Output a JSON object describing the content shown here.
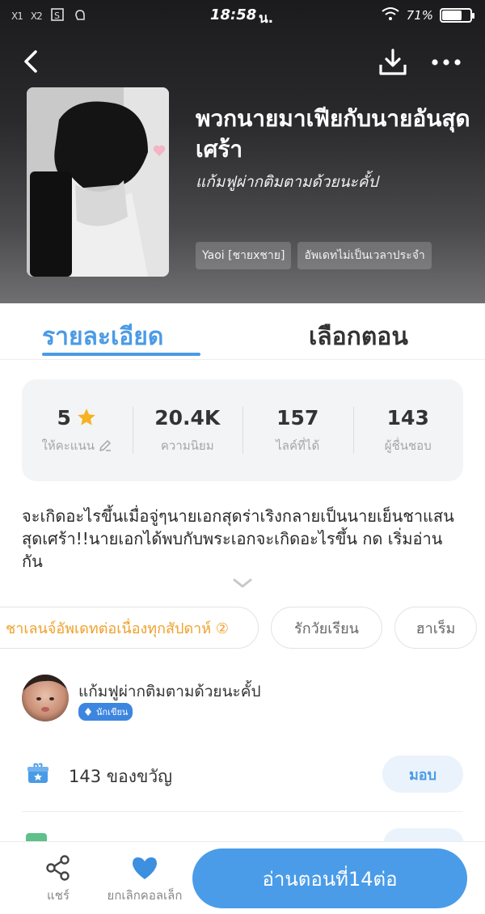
{
  "status_bar": {
    "sim1": "X1",
    "sim2": "X2",
    "time": "18:58",
    "carrier_mark": "น.",
    "battery_text": "71%",
    "battery_level": 0.71
  },
  "header": {
    "title": "พวกนายมาเฟียกับนายอันสุดเศร้า",
    "author": "แก้มฟูผ่ากติมตามด้วยนะคั้ป",
    "tags": [
      "Yaoi [ชายxชาย]",
      "อัพเดทไม่เป็นเวลาประจำ"
    ]
  },
  "tabs": [
    {
      "label": "รายละเอียด",
      "active": true
    },
    {
      "label": "เลือกตอน",
      "active": false
    }
  ],
  "stats": [
    {
      "value": "5",
      "label": "ให้คะแนน",
      "icon": "star-icon"
    },
    {
      "value": "20.4K",
      "label": "ความนิยม"
    },
    {
      "value": "157",
      "label": "ไลค์ที่ได้"
    },
    {
      "value": "143",
      "label": "ผู้ชื่นชอบ"
    }
  ],
  "synopsis": "จะเกิดอะไรขึ้นเมื่อจู่ๆนายเอกสุดร่าเริงกลายเป็นนายเย็นชาแสนสุดเศร้า!!นายเอกได้พบกับพระเอกจะเกิดอะไรขึ้น กด เริ่มอ่าน กัน",
  "chips": [
    {
      "label": "ชาเลนจ์อัพเดทต่อเนื่องทุกสัปดาห์ ②",
      "highlight": true
    },
    {
      "label": "รักวัยเรียน",
      "highlight": false
    },
    {
      "label": "ฮาเร็ม",
      "highlight": false
    }
  ],
  "author_section": {
    "name": "แก้มฟูผ่ากติมตามด้วยนะคั้ป",
    "badge": "นักเขียน"
  },
  "gift": {
    "text": "143 ของขวัญ",
    "button": "มอบ"
  },
  "bottom_bar": {
    "share_label": "แชร์",
    "fav_label": "ยกเลิกคอลเล็ก",
    "read_button": "อ่านตอนที่14ต่อ"
  },
  "colors": {
    "accent": "#4a9be6",
    "highlight_chip": "#f0a02a",
    "star": "#f5b321",
    "writer_badge": "#3d86e0"
  }
}
